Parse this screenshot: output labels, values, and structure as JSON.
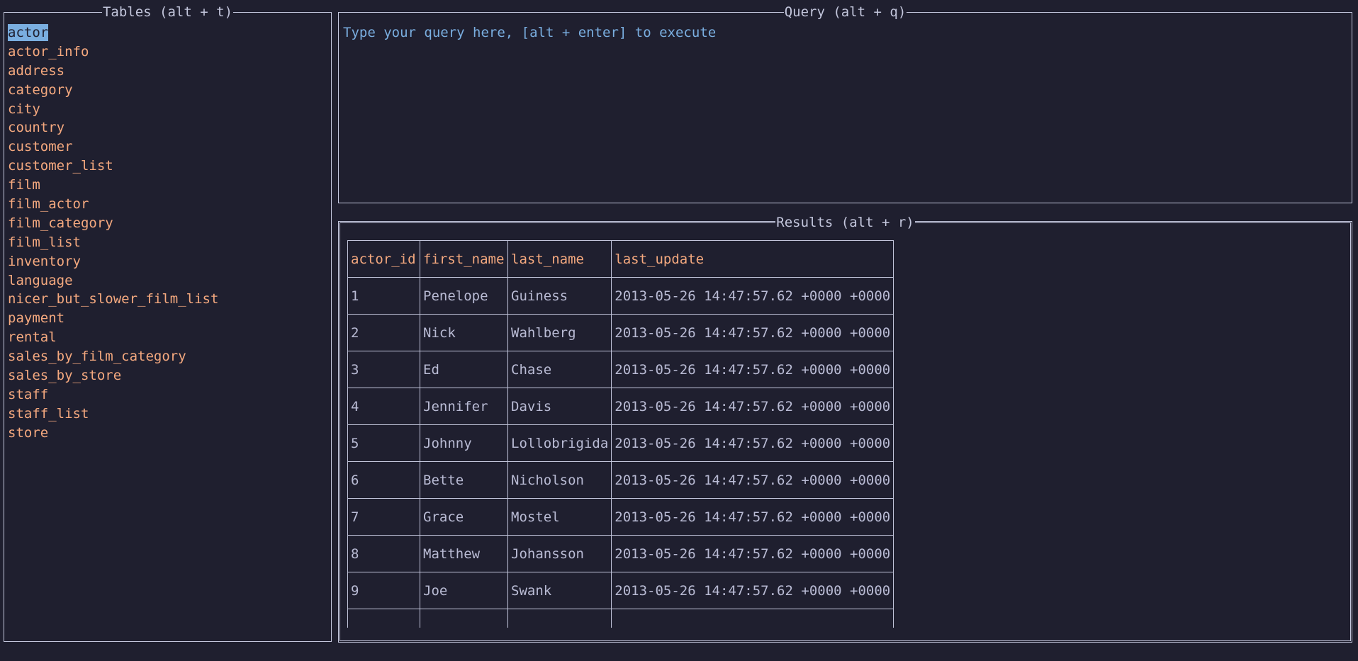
{
  "tables_panel": {
    "title": "Tables (alt + t)",
    "selected": "actor",
    "items": [
      "actor",
      "actor_info",
      "address",
      "category",
      "city",
      "country",
      "customer",
      "customer_list",
      "film",
      "film_actor",
      "film_category",
      "film_list",
      "inventory",
      "language",
      "nicer_but_slower_film_list",
      "payment",
      "rental",
      "sales_by_film_category",
      "sales_by_store",
      "staff",
      "staff_list",
      "store"
    ]
  },
  "query_panel": {
    "title": "Query (alt + q)",
    "placeholder": "Type your query here, [alt + enter] to execute"
  },
  "results_panel": {
    "title": "Results (alt + r)",
    "columns": [
      "actor_id",
      "first_name",
      "last_name",
      "last_update"
    ],
    "rows": [
      [
        "1",
        "Penelope",
        "Guiness",
        "2013-05-26 14:47:57.62 +0000 +0000"
      ],
      [
        "2",
        "Nick",
        "Wahlberg",
        "2013-05-26 14:47:57.62 +0000 +0000"
      ],
      [
        "3",
        "Ed",
        "Chase",
        "2013-05-26 14:47:57.62 +0000 +0000"
      ],
      [
        "4",
        "Jennifer",
        "Davis",
        "2013-05-26 14:47:57.62 +0000 +0000"
      ],
      [
        "5",
        "Johnny",
        "Lollobrigida",
        "2013-05-26 14:47:57.62 +0000 +0000"
      ],
      [
        "6",
        "Bette",
        "Nicholson",
        "2013-05-26 14:47:57.62 +0000 +0000"
      ],
      [
        "7",
        "Grace",
        "Mostel",
        "2013-05-26 14:47:57.62 +0000 +0000"
      ],
      [
        "8",
        "Matthew",
        "Johansson",
        "2013-05-26 14:47:57.62 +0000 +0000"
      ],
      [
        "9",
        "Joe",
        "Swank",
        "2013-05-26 14:47:57.62 +0000 +0000"
      ],
      [
        "",
        "",
        "",
        ""
      ]
    ]
  },
  "colors": {
    "background": "#1f1f2f",
    "border": "#c3c6dc",
    "accent": "#f5a97f",
    "selection": "#7aaee0",
    "text": "#b9bbd4"
  }
}
